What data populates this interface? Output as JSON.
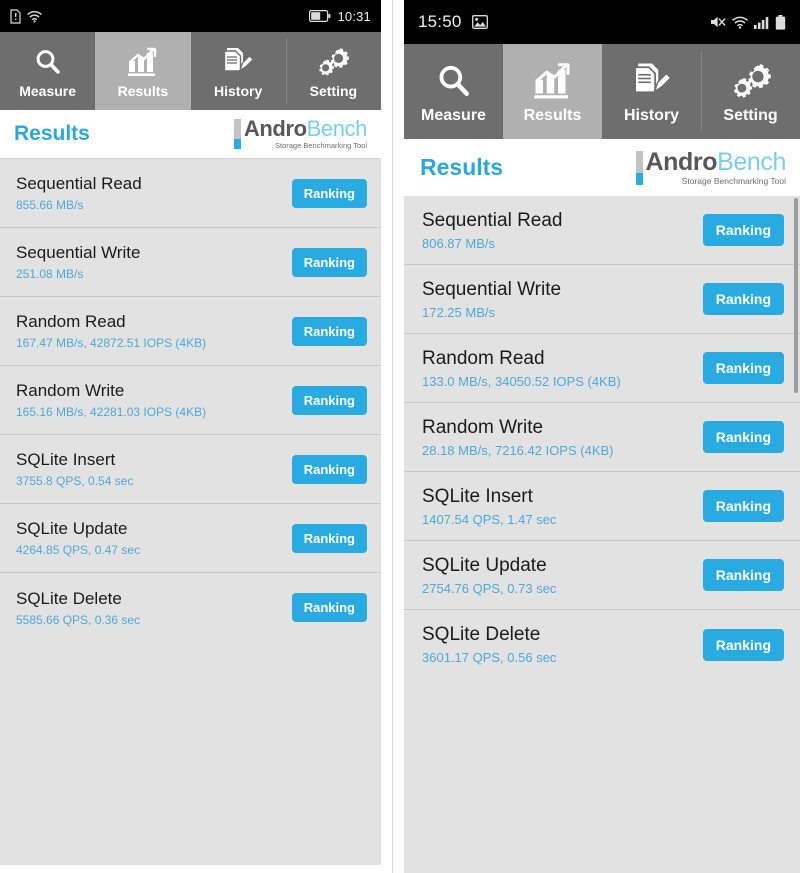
{
  "app": {
    "logo_main_part1": "Andro",
    "logo_main_part2": "Bench",
    "logo_tagline": "Storage Benchmarking Tool",
    "accent_blue": "#29abe2",
    "value_blue": "#4ea8d8",
    "tabbar_bg": "#6e6e6e",
    "tab_active_bg": "#b0b0b0",
    "list_bg": "#e2e2e2"
  },
  "tabs": [
    {
      "id": "measure",
      "label": "Measure",
      "icon": "magnifier-icon",
      "active": false
    },
    {
      "id": "results",
      "label": "Results",
      "icon": "bar-chart-arrow-icon",
      "active": true
    },
    {
      "id": "history",
      "label": "History",
      "icon": "document-pencil-icon",
      "active": false
    },
    {
      "id": "setting",
      "label": "Setting",
      "icon": "gears-icon",
      "active": false
    }
  ],
  "left_phone": {
    "status_bar": {
      "time": "10:31",
      "left_icons": [
        "sim-card-icon",
        "wifi-icon"
      ],
      "right_icons": [
        "battery-icon"
      ]
    },
    "header": {
      "title": "Results"
    },
    "rows": [
      {
        "title": "Sequential Read",
        "value": "855.66 MB/s",
        "button": "Ranking"
      },
      {
        "title": "Sequential Write",
        "value": "251.08 MB/s",
        "button": "Ranking"
      },
      {
        "title": "Random Read",
        "value": "167.47 MB/s, 42872.51 IOPS (4KB)",
        "button": "Ranking"
      },
      {
        "title": "Random Write",
        "value": "165.16 MB/s, 42281.03 IOPS (4KB)",
        "button": "Ranking"
      },
      {
        "title": "SQLite Insert",
        "value": "3755.8 QPS, 0.54 sec",
        "button": "Ranking"
      },
      {
        "title": "SQLite Update",
        "value": "4264.85 QPS, 0.47 sec",
        "button": "Ranking"
      },
      {
        "title": "SQLite Delete",
        "value": "5585.66 QPS, 0.36 sec",
        "button": "Ranking"
      }
    ]
  },
  "right_phone": {
    "status_bar": {
      "time": "15:50",
      "left_icons": [
        "photo-icon"
      ],
      "right_icons": [
        "mute-icon",
        "wifi-icon",
        "signal-bars-icon",
        "battery-icon"
      ]
    },
    "header": {
      "title": "Results"
    },
    "rows": [
      {
        "title": "Sequential Read",
        "value": "806.87 MB/s",
        "button": "Ranking"
      },
      {
        "title": "Sequential Write",
        "value": "172.25 MB/s",
        "button": "Ranking"
      },
      {
        "title": "Random Read",
        "value": "133.0 MB/s, 34050.52 IOPS (4KB)",
        "button": "Ranking"
      },
      {
        "title": "Random Write",
        "value": "28.18 MB/s, 7216.42 IOPS (4KB)",
        "button": "Ranking"
      },
      {
        "title": "SQLite Insert",
        "value": "1407.54 QPS, 1.47 sec",
        "button": "Ranking"
      },
      {
        "title": "SQLite Update",
        "value": "2754.76 QPS, 0.73 sec",
        "button": "Ranking"
      },
      {
        "title": "SQLite Delete",
        "value": "3601.17 QPS, 0.56 sec",
        "button": "Ranking"
      }
    ]
  }
}
